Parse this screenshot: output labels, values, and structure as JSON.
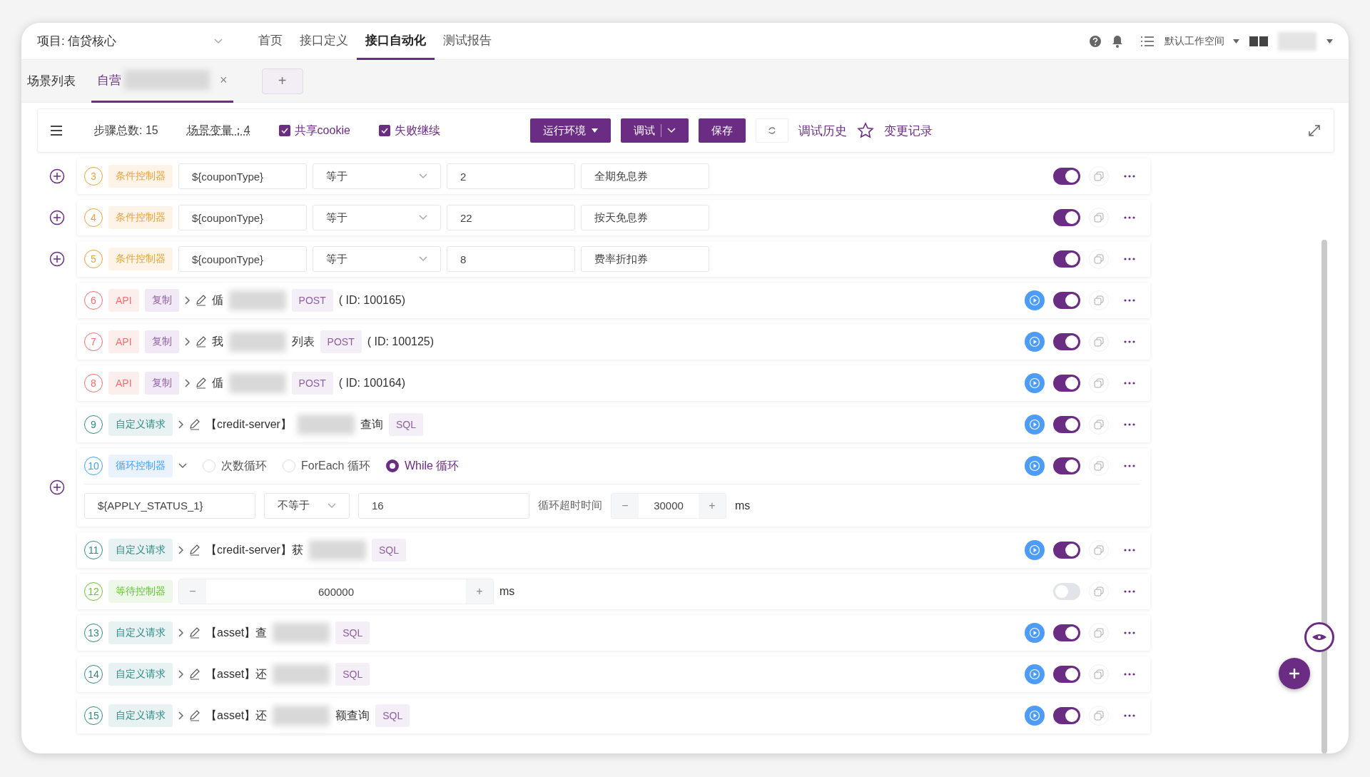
{
  "header": {
    "project": "项目: 信贷核心",
    "nav": [
      {
        "label": "首页",
        "selected": false
      },
      {
        "label": "接口定义",
        "selected": false
      },
      {
        "label": "接口自动化",
        "selected": true
      },
      {
        "label": "测试报告",
        "selected": false
      }
    ],
    "workspace": "默认工作空间"
  },
  "tabs": {
    "list_label": "场景列表",
    "items": [
      {
        "label": "自营",
        "selected": true,
        "close": "×"
      }
    ],
    "add": "+"
  },
  "toolbar": {
    "step_total": "步骤总数: 15",
    "variables": "场景变量：4",
    "checks": [
      {
        "label": "共享cookie",
        "checked": true
      },
      {
        "label": "失败继续",
        "checked": true
      }
    ],
    "env_button": "运行环境",
    "debug_button": "调试",
    "save_button": "保存",
    "history": "调试历史",
    "changes": "变更记录"
  },
  "steps": [
    {
      "kind": "condition",
      "index": "3",
      "tag": "条件控制器",
      "add_button": true,
      "enabled": true,
      "variable": "${couponType}",
      "operator": "等于",
      "value": "2",
      "note": "全期免息券"
    },
    {
      "kind": "condition",
      "index": "4",
      "tag": "条件控制器",
      "add_button": true,
      "enabled": true,
      "variable": "${couponType}",
      "operator": "等于",
      "value": "22",
      "note": "按天免息券"
    },
    {
      "kind": "condition",
      "index": "5",
      "tag": "条件控制器",
      "add_button": true,
      "enabled": true,
      "variable": "${couponType}",
      "operator": "等于",
      "value": "8",
      "note": "费率折扣券"
    },
    {
      "kind": "api",
      "index": "6",
      "tag": "API",
      "copy_tag": "复制",
      "name": "偱",
      "method": "POST",
      "id": "( ID: 100165)",
      "enabled": true
    },
    {
      "kind": "api",
      "index": "7",
      "tag": "API",
      "copy_tag": "复制",
      "name": "我",
      "name_end": "列表",
      "method": "POST",
      "id": "( ID: 100125)",
      "enabled": true
    },
    {
      "kind": "api",
      "index": "8",
      "tag": "API",
      "copy_tag": "复制",
      "name": "偱",
      "method": "POST",
      "id": "( ID: 100164)",
      "enabled": true
    },
    {
      "kind": "custom",
      "index": "9",
      "tag": "自定义请求",
      "name": "【credit-server】",
      "name_end": "查询",
      "method": "SQL",
      "enabled": true
    },
    {
      "kind": "loop",
      "index": "10",
      "tag": "循环控制器",
      "add_button": true,
      "enabled": true,
      "options": [
        {
          "label": "次数循环",
          "selected": false
        },
        {
          "label": "ForEach 循环",
          "selected": false
        },
        {
          "label": "While 循环",
          "selected": true
        }
      ],
      "variable": "${APPLY_STATUS_1}",
      "operator": "不等于",
      "value": "16",
      "timeout_label": "循环超时时间",
      "minus": "−",
      "timeout": "30000",
      "plus": "+",
      "unit": "ms"
    },
    {
      "kind": "custom",
      "index": "11",
      "tag": "自定义请求",
      "name": "【credit-server】获",
      "method": "SQL",
      "enabled": true
    },
    {
      "kind": "wait",
      "index": "12",
      "tag": "等待控制器",
      "minus": "−",
      "value": "600000",
      "plus": "+",
      "unit": "ms",
      "enabled": false
    },
    {
      "kind": "custom",
      "index": "13",
      "tag": "自定义请求",
      "name": "【asset】查",
      "method": "SQL",
      "enabled": true
    },
    {
      "kind": "custom",
      "index": "14",
      "tag": "自定义请求",
      "name": "【asset】还",
      "method": "SQL",
      "enabled": true
    },
    {
      "kind": "custom",
      "index": "15",
      "tag": "自定义请求",
      "name": "【asset】还",
      "name_end": "额查询",
      "method": "SQL",
      "enabled": true
    }
  ]
}
